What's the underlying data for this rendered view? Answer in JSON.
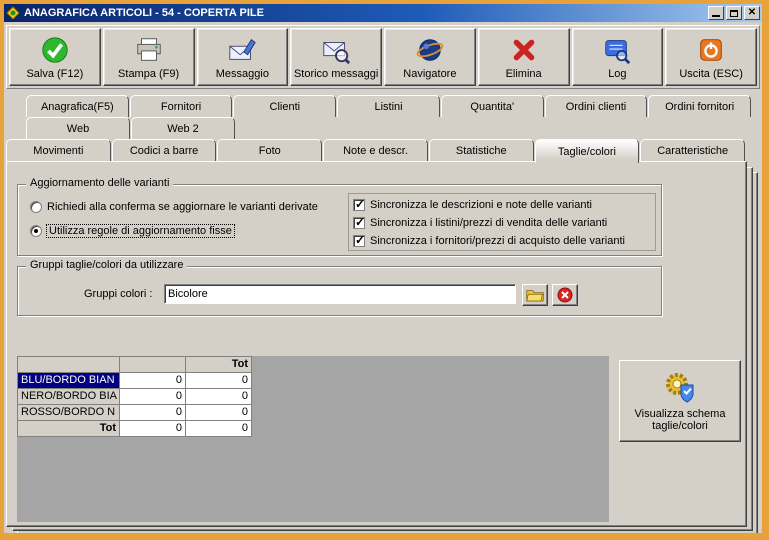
{
  "window": {
    "title": "ANAGRAFICA ARTICOLI - 54 - COPERTA PILE"
  },
  "colors": {
    "frame": "#E8A23C",
    "titlebar_start": "#0A246A",
    "titlebar_end": "#A6CAF0",
    "window_bg": "#D4D0C8",
    "selection": "#000080",
    "grid_bg": "#A5A5A5"
  },
  "toolbar": {
    "buttons": [
      {
        "label": "Salva (F12)",
        "icon": "save-check-icon"
      },
      {
        "label": "Stampa (F9)",
        "icon": "printer-icon"
      },
      {
        "label": "Messaggio",
        "icon": "message-pencil-icon"
      },
      {
        "label": "Storico messaggi",
        "icon": "message-history-icon"
      },
      {
        "label": "Navigatore",
        "icon": "navigator-icon"
      },
      {
        "label": "Elimina",
        "icon": "delete-x-icon"
      },
      {
        "label": "Log",
        "icon": "log-icon"
      },
      {
        "label": "Uscita (ESC)",
        "icon": "exit-power-icon"
      }
    ]
  },
  "tabs": {
    "row1": [
      "Anagrafica(F5)",
      "Fornitori",
      "Clienti",
      "Listini",
      "Quantita'",
      "Ordini clienti",
      "Ordini fornitori"
    ],
    "row2": [
      "Web",
      "Web 2"
    ],
    "row3": [
      "Movimenti",
      "Codici a barre",
      "Foto",
      "Note e descr.",
      "Statistiche",
      "Taglie/colori",
      "Caratteristiche"
    ],
    "active_tab": "Taglie/colori"
  },
  "variants": {
    "title": "Aggiornamento delle varianti",
    "radios": [
      {
        "label": "Richiedi alla conferma se aggiornare le varianti derivate",
        "checked": false
      },
      {
        "label": "Utilizza regole di aggiornamento fisse",
        "checked": true
      }
    ],
    "checkboxes": [
      {
        "label": "Sincronizza le descrizioni e note delle varianti",
        "checked": true
      },
      {
        "label": "Sincronizza i listini/prezzi di vendita delle varianti",
        "checked": true
      },
      {
        "label": "Sincronizza i fornitori/prezzi di acquisto delle varianti",
        "checked": true
      }
    ]
  },
  "groups": {
    "title": "Gruppi taglie/colori da utilizzare",
    "field_label": "Gruppi colori :",
    "value": "Bicolore"
  },
  "grid": {
    "header": [
      "",
      "",
      "Tot"
    ],
    "rows": [
      {
        "label": "BLU/BORDO BIAN",
        "values": [
          "0",
          "0"
        ],
        "selected": true
      },
      {
        "label": "NERO/BORDO BIA",
        "values": [
          "0",
          "0"
        ],
        "selected": false
      },
      {
        "label": "ROSSO/BORDO N",
        "values": [
          "0",
          "0"
        ],
        "selected": false
      },
      {
        "label": "Tot",
        "values": [
          "0",
          "0"
        ],
        "selected": false,
        "bold": true
      }
    ]
  },
  "schema_button": {
    "label": "Visualizza schema taglie/colori"
  }
}
